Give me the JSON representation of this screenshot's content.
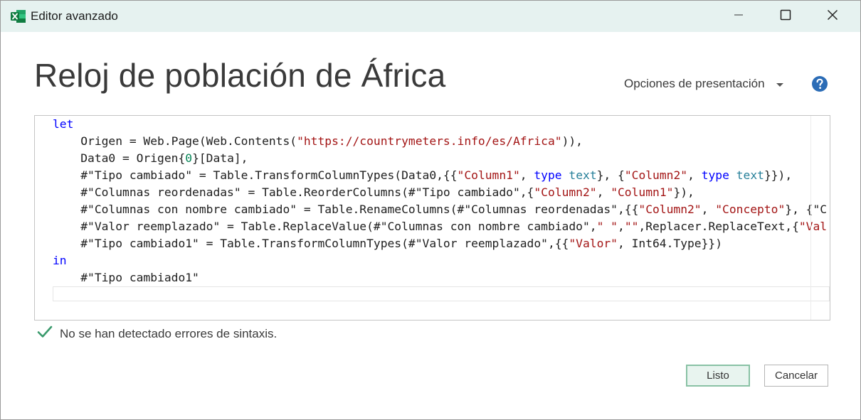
{
  "window": {
    "title": "Editor avanzado",
    "app_icon": "excel-icon",
    "controls": {
      "minimize": "minimize-icon",
      "maximize": "maximize-icon",
      "close": "close-icon"
    }
  },
  "header": {
    "query_title": "Reloj de población de África",
    "display_options_label": "Opciones de presentación",
    "help_icon": "help-icon"
  },
  "editor": {
    "lines": [
      [
        {
          "t": "let",
          "c": "kw"
        }
      ],
      [
        {
          "t": "    Origen = Web.Page(Web.Contents(",
          "c": ""
        },
        {
          "t": "\"https://countrymeters.info/es/Africa\"",
          "c": "str"
        },
        {
          "t": ")),",
          "c": ""
        }
      ],
      [
        {
          "t": "    Data0 = Origen{",
          "c": ""
        },
        {
          "t": "0",
          "c": "num"
        },
        {
          "t": "}[Data],",
          "c": ""
        }
      ],
      [
        {
          "t": "    #\"Tipo cambiado\" = Table.TransformColumnTypes(Data0,{{",
          "c": ""
        },
        {
          "t": "\"Column1\"",
          "c": "str"
        },
        {
          "t": ", ",
          "c": ""
        },
        {
          "t": "type",
          "c": "kw"
        },
        {
          "t": " ",
          "c": ""
        },
        {
          "t": "text",
          "c": "typ"
        },
        {
          "t": "}, {",
          "c": ""
        },
        {
          "t": "\"Column2\"",
          "c": "str"
        },
        {
          "t": ", ",
          "c": ""
        },
        {
          "t": "type",
          "c": "kw"
        },
        {
          "t": " ",
          "c": ""
        },
        {
          "t": "text",
          "c": "typ"
        },
        {
          "t": "}}),",
          "c": ""
        }
      ],
      [
        {
          "t": "    #\"Columnas reordenadas\" = Table.ReorderColumns(#\"Tipo cambiado\",{",
          "c": ""
        },
        {
          "t": "\"Column2\"",
          "c": "str"
        },
        {
          "t": ", ",
          "c": ""
        },
        {
          "t": "\"Column1\"",
          "c": "str"
        },
        {
          "t": "}),",
          "c": ""
        }
      ],
      [
        {
          "t": "    #\"Columnas con nombre cambiado\" = Table.RenameColumns(#\"Columnas reordenadas\",{{",
          "c": ""
        },
        {
          "t": "\"Column2\"",
          "c": "str"
        },
        {
          "t": ", ",
          "c": ""
        },
        {
          "t": "\"Concepto\"",
          "c": "str"
        },
        {
          "t": "}, {\"C",
          "c": ""
        }
      ],
      [
        {
          "t": "    #\"Valor reemplazado\" = Table.ReplaceValue(#\"Columnas con nombre cambiado\",",
          "c": ""
        },
        {
          "t": "\" \"",
          "c": "str"
        },
        {
          "t": ",",
          "c": ""
        },
        {
          "t": "\"\"",
          "c": "str"
        },
        {
          "t": ",Replacer.ReplaceText,{",
          "c": ""
        },
        {
          "t": "\"Val",
          "c": "str"
        }
      ],
      [
        {
          "t": "    #\"Tipo cambiado1\" = Table.TransformColumnTypes(#\"Valor reemplazado\",{{",
          "c": ""
        },
        {
          "t": "\"Valor\"",
          "c": "str"
        },
        {
          "t": ", Int64.Type}})",
          "c": ""
        }
      ],
      [
        {
          "t": "in",
          "c": "kw"
        }
      ],
      [
        {
          "t": "    #\"Tipo cambiado1\"",
          "c": ""
        }
      ],
      [
        {
          "t": "",
          "c": ""
        }
      ]
    ]
  },
  "status": {
    "icon": "checkmark-icon",
    "message": "No se han detectado errores de sintaxis."
  },
  "buttons": {
    "ok_label": "Listo",
    "cancel_label": "Cancelar"
  },
  "colors": {
    "titlebar_bg": "#e6f2f0",
    "keyword": "#0000ff",
    "string": "#a31515",
    "number": "#098658",
    "type": "#267f99",
    "status_check": "#3a9a6c",
    "primary_border": "#89c2a5",
    "help_blue": "#2b6cb6",
    "excel_green": "#107c41"
  }
}
